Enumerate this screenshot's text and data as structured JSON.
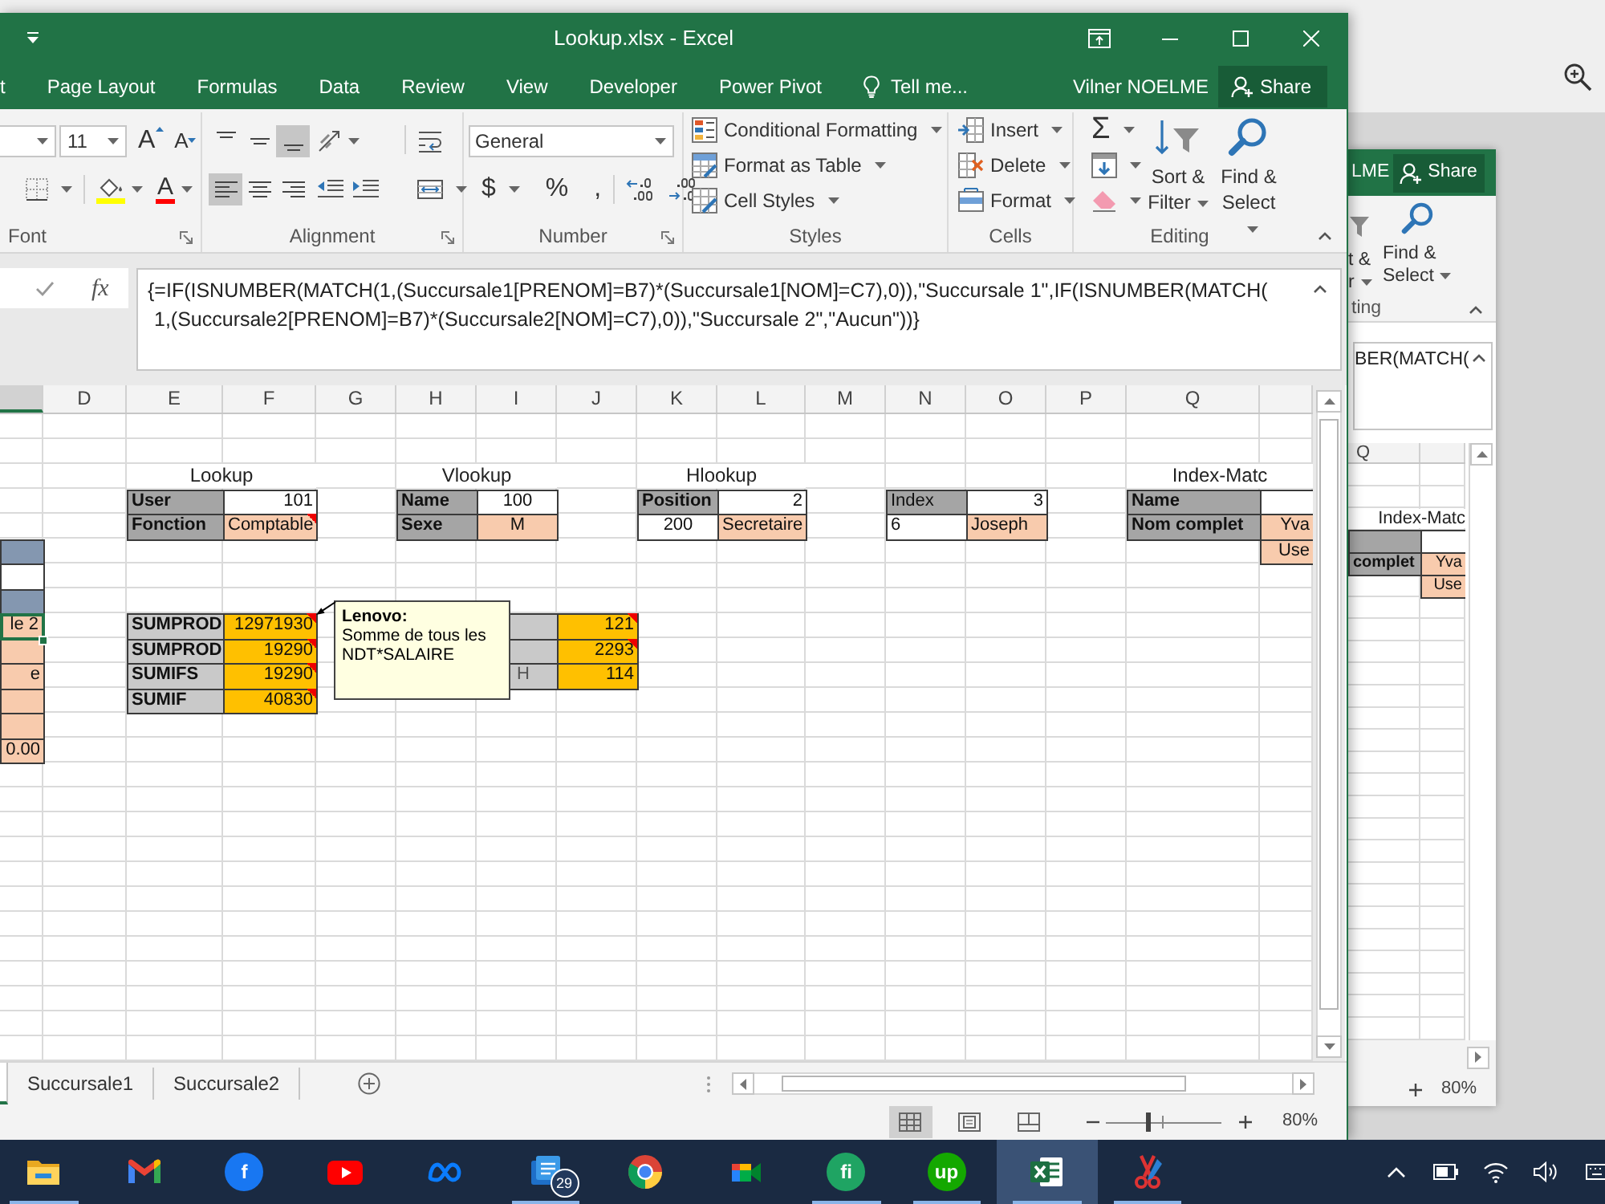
{
  "window": {
    "title": "Lookup.xlsx - Excel",
    "user": "Vilner NOELME",
    "share": "Share"
  },
  "ribbon_tabs": [
    {
      "label": "t",
      "selected": false
    },
    {
      "label": "Page Layout",
      "selected": false
    },
    {
      "label": "Formulas",
      "selected": false
    },
    {
      "label": "Data",
      "selected": false
    },
    {
      "label": "Review",
      "selected": false
    },
    {
      "label": "View",
      "selected": false
    },
    {
      "label": "Developer",
      "selected": false
    },
    {
      "label": "Power Pivot",
      "selected": false
    }
  ],
  "tell_me": {
    "placeholder": "Tell me..."
  },
  "ribbon": {
    "font": {
      "label": "Font",
      "size": "11",
      "grow": "A",
      "shrink": "A",
      "color_letter": "A"
    },
    "alignment": {
      "label": "Alignment",
      "vertical": [
        {
          "kind": "top",
          "selected": false
        },
        {
          "kind": "middle",
          "selected": false
        },
        {
          "kind": "bottom",
          "selected": true
        }
      ],
      "horizontal": [
        {
          "kind": "left",
          "selected": true
        },
        {
          "kind": "center",
          "selected": false
        },
        {
          "kind": "right",
          "selected": false
        }
      ]
    },
    "number": {
      "label": "Number",
      "format": "General",
      "symbols": [
        {
          "label": "$",
          "dropdown": true
        },
        {
          "label": "%",
          "dropdown": false
        },
        {
          "label": ",",
          "dropdown": false
        }
      ]
    },
    "styles": {
      "label": "Styles",
      "commands": [
        {
          "kind": "conditional_formatting",
          "label": "Conditional Formatting"
        },
        {
          "kind": "table",
          "label": "Format as Table"
        },
        {
          "kind": "cell_styles",
          "label": "Cell Styles"
        }
      ]
    },
    "cells": {
      "label": "Cells",
      "commands": [
        {
          "kind": "insert",
          "label": "Insert"
        },
        {
          "kind": "delete",
          "label": "Delete"
        },
        {
          "kind": "format",
          "label": "Format"
        }
      ]
    },
    "editing": {
      "label": "Editing",
      "autosum": "Σ",
      "commands": [
        {
          "kind": "sort_filter",
          "label": "Sort & Filter"
        },
        {
          "kind": "find_select",
          "label": "Find & Select"
        }
      ]
    }
  },
  "formula_bar": {
    "function_label": "fx",
    "lines": [
      "{=IF(ISNUMBER(MATCH(1,(Succursale1[PRENOM]=B7)*(Succursale1[NOM]=C7),0)),\"Succursale 1\",IF(ISNUMBER(MATCH(",
      "1,(Succursale2[PRENOM]=B7)*(Succursale2[NOM]=C7),0)),\"Succursale 2\",\"Aucun\"))}"
    ]
  },
  "sheet": {
    "columns": [
      "D",
      "E",
      "F",
      "G",
      "H",
      "I",
      "J",
      "K",
      "L",
      "M",
      "N",
      "O",
      "P",
      "Q"
    ],
    "blocks": [
      {
        "title": "Lookup",
        "rows": [
          [
            {
              "text": "User",
              "kind": "heading",
              "comment": false,
              "selected": false
            },
            {
              "text": "101",
              "kind": "value_right",
              "comment": false,
              "selected": false
            }
          ],
          [
            {
              "text": "Fonction",
              "kind": "heading",
              "comment": false,
              "selected": false
            },
            {
              "text": "Comptable",
              "kind": "result_right",
              "comment": true,
              "selected": false
            }
          ]
        ]
      },
      {
        "title": "Vlookup",
        "rows": [
          [
            {
              "text": "Name",
              "kind": "heading",
              "comment": false,
              "selected": false
            },
            {
              "text": "100",
              "kind": "value_center",
              "comment": false,
              "selected": false
            }
          ],
          [
            {
              "text": "Sexe",
              "kind": "heading",
              "comment": false,
              "selected": false
            },
            {
              "text": "M",
              "kind": "result_center",
              "comment": false,
              "selected": false
            }
          ]
        ]
      },
      {
        "title": "Hlookup",
        "rows": [
          [
            {
              "text": "Position",
              "kind": "heading",
              "comment": false,
              "selected": false
            },
            {
              "text": "2",
              "kind": "value_right",
              "comment": false,
              "selected": false
            }
          ],
          [
            {
              "text": "200",
              "kind": "value_center",
              "comment": false,
              "selected": false
            },
            {
              "text": "Secretaire",
              "kind": "result",
              "comment": false,
              "selected": false
            }
          ]
        ]
      },
      {
        "rows": [
          [
            {
              "text": "Index",
              "kind": "caption",
              "comment": false,
              "selected": false
            },
            {
              "text": "3",
              "kind": "value_right",
              "comment": false,
              "selected": false
            }
          ],
          [
            {
              "text": "6",
              "kind": "value",
              "comment": false,
              "selected": false
            },
            {
              "text": "Joseph",
              "kind": "result",
              "comment": false,
              "selected": false
            }
          ]
        ]
      },
      {
        "title": "Index-Matc",
        "rows": [
          [
            {
              "text": "Name",
              "kind": "heading",
              "comment": false,
              "selected": false
            },
            {
              "kind": "value",
              "comment": false,
              "selected": false
            }
          ],
          [
            {
              "text": "Nom complet",
              "kind": "heading",
              "comment": false,
              "selected": false
            },
            {
              "text": "Yva",
              "kind": "result_right",
              "comment": false,
              "selected": false
            }
          ],
          [
            null,
            {
              "text": "Use",
              "kind": "result_right",
              "comment": false,
              "selected": false
            }
          ]
        ]
      },
      {
        "rows": [
          [
            {
              "kind": "band",
              "comment": false,
              "selected": false
            }
          ],
          [
            {
              "kind": "value",
              "comment": false,
              "selected": false
            }
          ],
          [
            {
              "kind": "band",
              "comment": false,
              "selected": false
            }
          ],
          [
            {
              "text": "le 2",
              "kind": "result_right",
              "comment": false,
              "selected": true
            }
          ],
          [
            {
              "kind": "result",
              "comment": false,
              "selected": false
            }
          ],
          [
            {
              "text": "e",
              "kind": "result_right",
              "comment": false,
              "selected": false
            }
          ],
          [
            {
              "kind": "result",
              "comment": false,
              "selected": false
            }
          ],
          [
            {
              "kind": "result",
              "comment": false,
              "selected": false
            }
          ],
          [
            {
              "text": "0.00",
              "kind": "result_right",
              "comment": false,
              "selected": false
            }
          ]
        ]
      },
      {
        "rows": [
          [
            {
              "text": "SUMPROD",
              "kind": "sum_label",
              "comment": false,
              "selected": false
            },
            {
              "text": "12971930",
              "kind": "total",
              "comment": true,
              "selected": false
            }
          ],
          [
            {
              "text": "SUMPROD",
              "kind": "sum_label",
              "comment": false,
              "selected": false
            },
            {
              "text": "19290",
              "kind": "total",
              "comment": true,
              "selected": false
            }
          ],
          [
            {
              "text": "SUMIFS",
              "kind": "sum_label",
              "comment": false,
              "selected": false
            },
            {
              "text": "19290",
              "kind": "total",
              "comment": true,
              "selected": false
            }
          ],
          [
            {
              "text": "SUMIF",
              "kind": "sum_label",
              "comment": false,
              "selected": false
            },
            {
              "text": "40830",
              "kind": "total",
              "comment": true,
              "selected": false
            }
          ]
        ]
      },
      {
        "rows": [
          [
            {
              "kind": "note",
              "comment": false,
              "selected": false
            },
            {
              "text": "121",
              "kind": "total",
              "comment": true,
              "selected": false
            }
          ],
          [
            {
              "kind": "note",
              "comment": false,
              "selected": false
            },
            {
              "text": "2293",
              "kind": "total",
              "comment": true,
              "selected": false
            }
          ],
          [
            {
              "text": "H",
              "kind": "note",
              "comment": false,
              "selected": false
            },
            {
              "text": "114",
              "kind": "total",
              "comment": false,
              "selected": false
            }
          ]
        ]
      }
    ],
    "comment": {
      "author": "Lenovo:",
      "text": "Somme de tous les NDT*SALAIRE"
    }
  },
  "sheet_tabs": [
    {
      "selected": true
    },
    {
      "label": "Succursale1",
      "selected": false
    },
    {
      "label": "Succursale2",
      "selected": false
    }
  ],
  "status_bar": {
    "views": [
      {
        "kind": "normal",
        "selected": true
      },
      {
        "kind": "page_layout",
        "selected": false
      },
      {
        "kind": "page_break",
        "selected": false
      }
    ],
    "zoom": {
      "level": 0.36,
      "reading": "80%"
    }
  },
  "background_window": {
    "user": "LME",
    "share": "Share",
    "commands": [
      {
        "kind": "sort_filter",
        "lines": [
          "t &",
          "r"
        ]
      },
      {
        "kind": "find_select",
        "lines": [
          "Find &",
          "Select"
        ]
      }
    ],
    "group_label": "ting",
    "formula": "BER(MATCH(",
    "columns": [
      "Q"
    ],
    "title": "Index-Matc",
    "rows": [
      [
        {
          "kind": "heading",
          "comment": false,
          "selected": false
        },
        {
          "kind": "value",
          "comment": false,
          "selected": false
        }
      ],
      [
        {
          "text": "complet",
          "kind": "heading",
          "comment": false,
          "selected": false
        },
        {
          "text": "Yva",
          "kind": "result_right",
          "comment": false,
          "selected": false
        }
      ],
      [
        null,
        {
          "text": "Use",
          "kind": "result_right",
          "comment": false,
          "selected": false
        }
      ]
    ],
    "zoom": "80%"
  },
  "taskbar": {
    "apps": [
      {
        "kind": "explorer",
        "running": true,
        "selected": false
      },
      {
        "kind": "gmail",
        "running": false,
        "selected": false
      },
      {
        "kind": "logo",
        "text": "f",
        "color": "#1877f2",
        "running": false,
        "selected": false
      },
      {
        "kind": "youtube",
        "running": false,
        "selected": false
      },
      {
        "kind": "meta",
        "running": false,
        "selected": false
      },
      {
        "kind": "tile",
        "badge": "29",
        "running": true,
        "selected": false
      },
      {
        "kind": "chrome",
        "running": false,
        "selected": false
      },
      {
        "kind": "meet",
        "running": false,
        "selected": false
      },
      {
        "kind": "logo",
        "text": "fi",
        "color": "#1fa463",
        "running": true,
        "selected": false
      },
      {
        "kind": "logo",
        "text": "up",
        "color": "#14a800",
        "running": true,
        "selected": false
      },
      {
        "kind": "excel",
        "running": true,
        "selected": true
      },
      {
        "kind": "snip",
        "running": true,
        "selected": false
      }
    ]
  }
}
